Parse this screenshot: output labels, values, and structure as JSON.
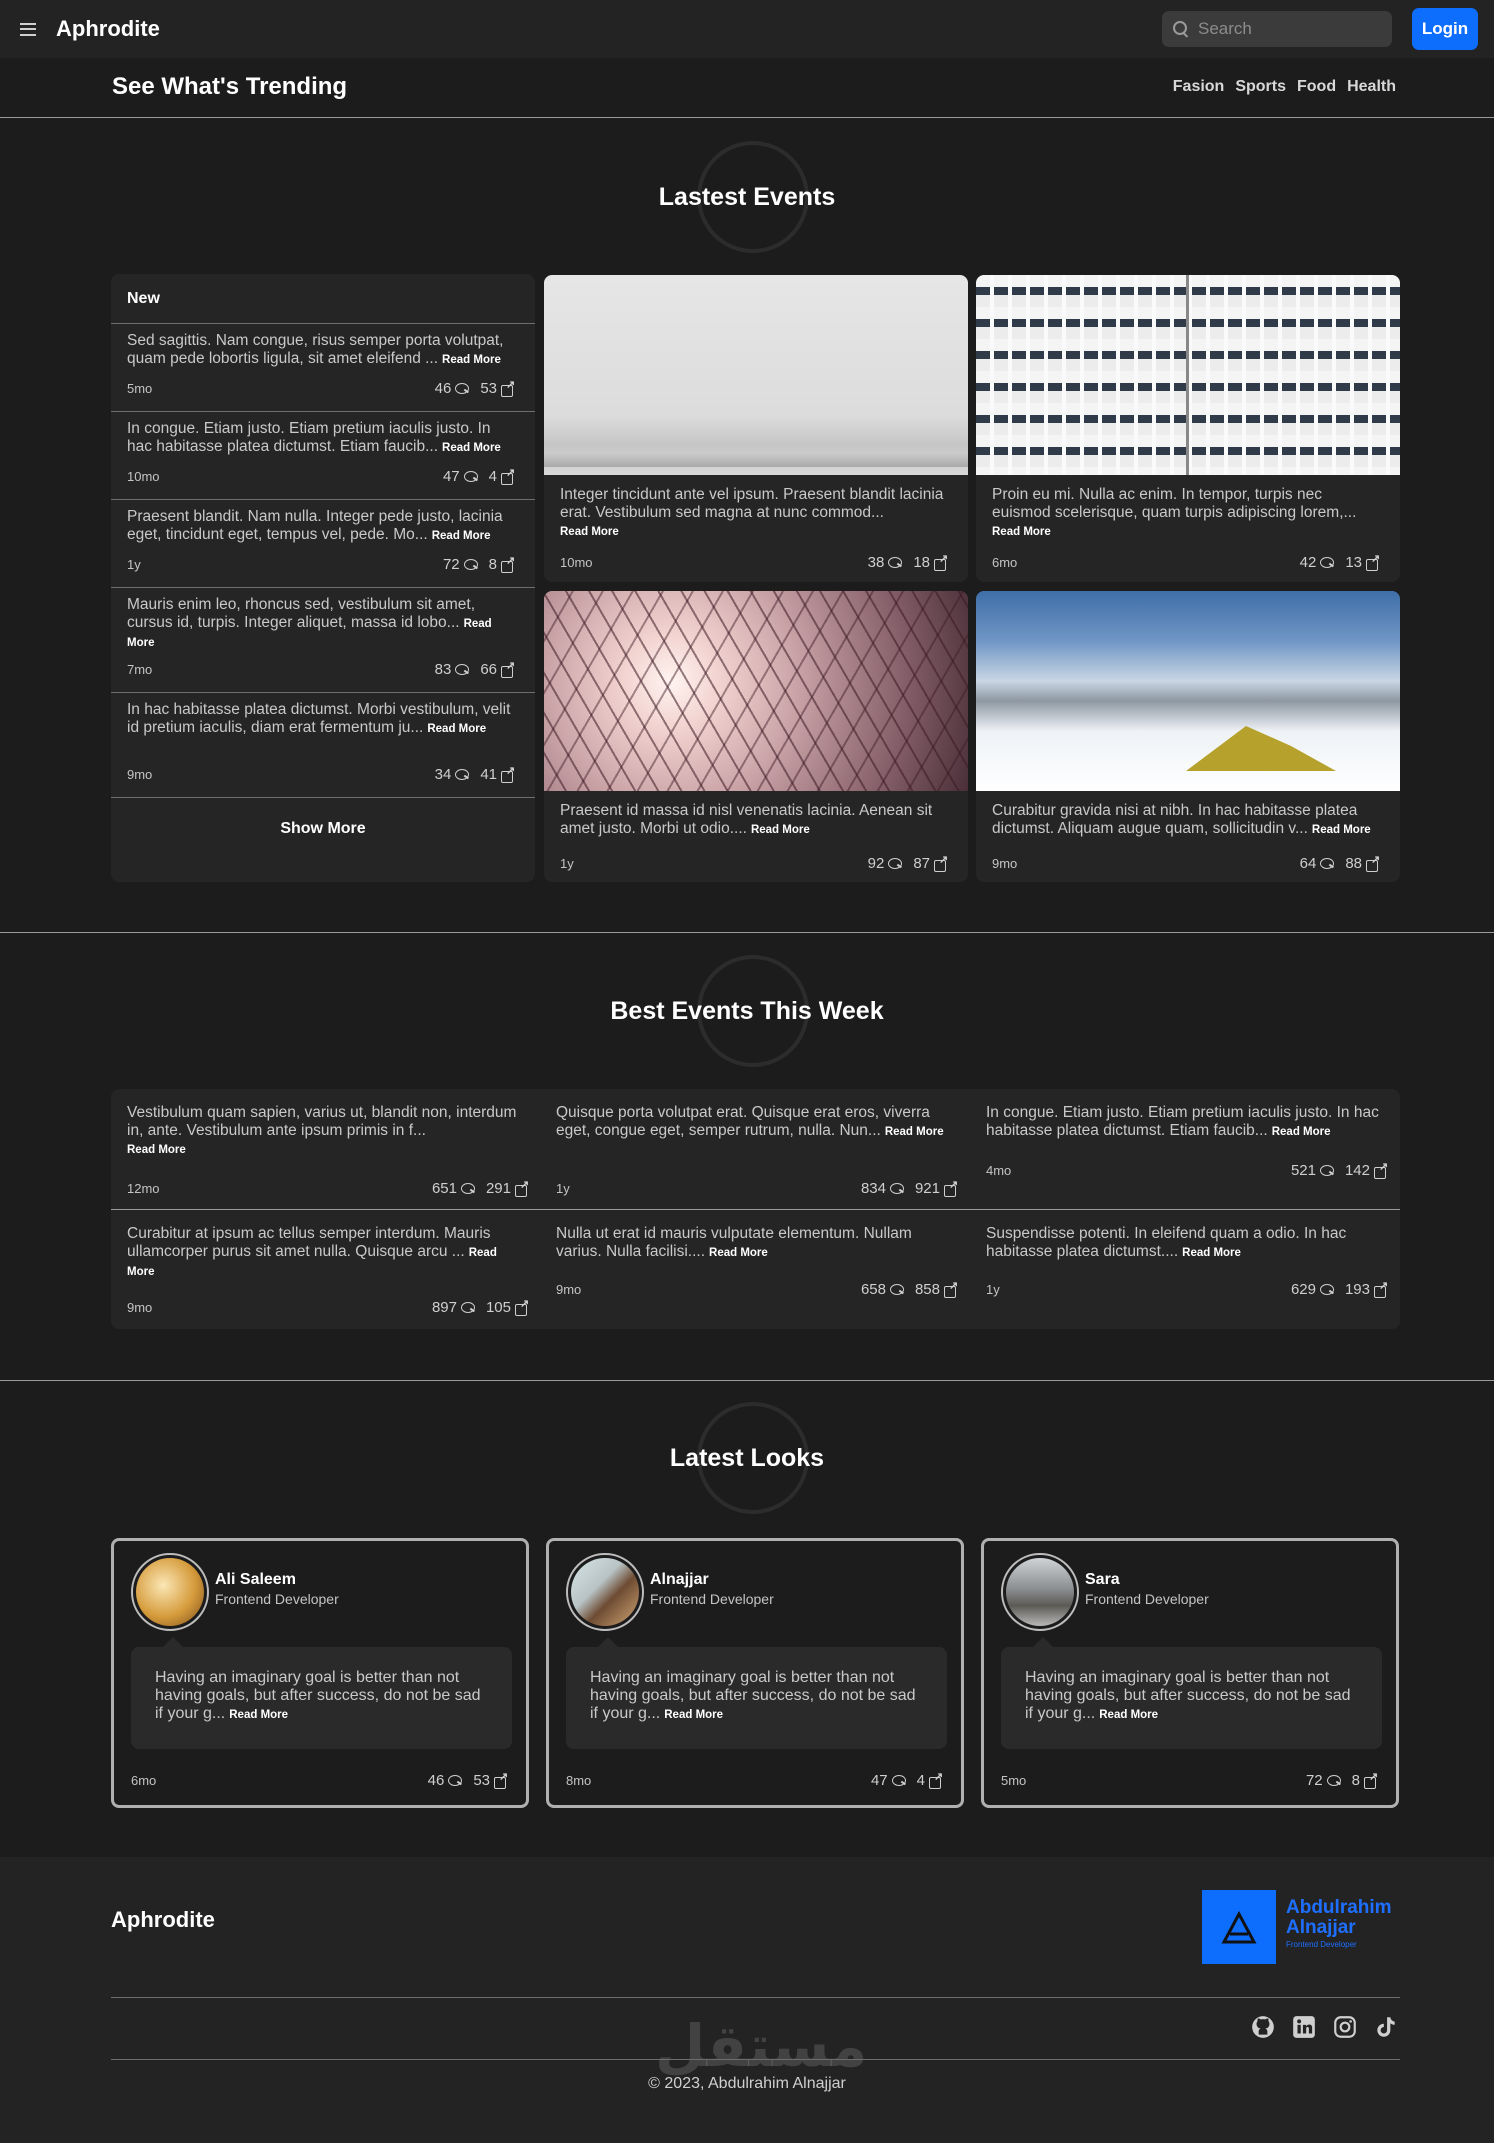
{
  "navbar": {
    "brand": "Aphrodite",
    "search_placeholder": "Search",
    "login_label": "Login"
  },
  "trending": {
    "title": "See What's Trending",
    "links": [
      "Fasion",
      "Sports",
      "Food",
      "Health"
    ]
  },
  "latest_events": {
    "heading": "Lastest Events",
    "new_label": "New",
    "read_more": "Read More",
    "show_more": "Show More",
    "new_items": [
      {
        "text": "Sed sagittis. Nam congue, risus semper porta volutpat, quam pede lobortis ligula, sit amet eleifend ...",
        "time": "5mo",
        "comments": "46",
        "shares": "53"
      },
      {
        "text": "In congue. Etiam justo. Etiam pretium iaculis justo. In hac habitasse platea dictumst. Etiam faucib...",
        "time": "10mo",
        "comments": "47",
        "shares": "4"
      },
      {
        "text": "Praesent blandit. Nam nulla. Integer pede justo, lacinia eget, tincidunt eget, tempus vel, pede. Mo...",
        "time": "1y",
        "comments": "72",
        "shares": "8"
      },
      {
        "text": "Mauris enim leo, rhoncus sed, vestibulum sit amet, cursus id, turpis. Integer aliquet, massa id lobo...",
        "time": "7mo",
        "comments": "83",
        "shares": "66"
      },
      {
        "text": "In hac habitasse platea dictumst. Morbi vestibulum, velit id pretium iaculis, diam erat fermentum ju...",
        "time": "9mo",
        "comments": "34",
        "shares": "41"
      }
    ],
    "cards": [
      {
        "text": "Integer tincidunt ante vel ipsum. Praesent blandit lacinia erat. Vestibulum sed magna at nunc commod...",
        "time": "10mo",
        "comments": "38",
        "shares": "18"
      },
      {
        "text": "Proin eu mi. Nulla ac enim. In tempor, turpis nec euismod scelerisque, quam turpis adipiscing lorem,...",
        "time": "6mo",
        "comments": "42",
        "shares": "13"
      },
      {
        "text": "Praesent id massa id nisl venenatis lacinia. Aenean sit amet justo. Morbi ut odio....",
        "time": "1y",
        "comments": "92",
        "shares": "87"
      },
      {
        "text": "Curabitur gravida nisi at nibh. In hac habitasse platea dictumst. Aliquam augue quam, sollicitudin v...",
        "time": "9mo",
        "comments": "64",
        "shares": "88"
      }
    ]
  },
  "best_events": {
    "heading": "Best Events This Week",
    "items": [
      {
        "text": "Vestibulum quam sapien, varius ut, blandit non, interdum in, ante. Vestibulum ante ipsum primis in f...",
        "time": "12mo",
        "comments": "651",
        "shares": "291"
      },
      {
        "text": "Quisque porta volutpat erat. Quisque erat eros, viverra eget, congue eget, semper rutrum, nulla. Nun...",
        "time": "1y",
        "comments": "834",
        "shares": "921"
      },
      {
        "text": "In congue. Etiam justo. Etiam pretium iaculis justo. In hac habitasse platea dictumst. Etiam faucib...",
        "time": "4mo",
        "comments": "521",
        "shares": "142"
      },
      {
        "text": "Curabitur at ipsum ac tellus semper interdum. Mauris ullamcorper purus sit amet nulla. Quisque arcu ...",
        "time": "9mo",
        "comments": "897",
        "shares": "105"
      },
      {
        "text": "Nulla ut erat id mauris vulputate elementum. Nullam varius. Nulla facilisi....",
        "time": "9mo",
        "comments": "658",
        "shares": "858"
      },
      {
        "text": "Suspendisse potenti. In eleifend quam a odio. In hac habitasse platea dictumst....",
        "time": "1y",
        "comments": "629",
        "shares": "193"
      }
    ]
  },
  "latest_looks": {
    "heading": "Latest Looks",
    "items": [
      {
        "name": "Ali Saleem",
        "role": "Frontend Developer",
        "quote": "Having an imaginary goal is better than not having goals, but after success, do not be sad if your g...",
        "time": "6mo",
        "comments": "46",
        "shares": "53"
      },
      {
        "name": "Alnajjar",
        "role": "Frontend Developer",
        "quote": "Having an imaginary goal is better than not having goals, but after success, do not be sad if your g...",
        "time": "8mo",
        "comments": "47",
        "shares": "4"
      },
      {
        "name": "Sara",
        "role": "Frontend Developer",
        "quote": "Having an imaginary goal is better than not having goals, but after success, do not be sad if your g...",
        "time": "5mo",
        "comments": "72",
        "shares": "8"
      }
    ]
  },
  "footer": {
    "brand": "Aphrodite",
    "logo_name_line1": "Abdulrahim",
    "logo_name_line2": "Alnajjar",
    "logo_role": "Frontend Developer",
    "socials": [
      "github-icon",
      "linkedin-icon",
      "instagram-icon",
      "tiktok-icon"
    ],
    "copyright": "© 2023, Abdulrahim Alnajjar",
    "watermark": "مستقل"
  },
  "colors": {
    "accent": "#0d6efd",
    "background": "#1c1c1d",
    "panel": "#252526"
  }
}
